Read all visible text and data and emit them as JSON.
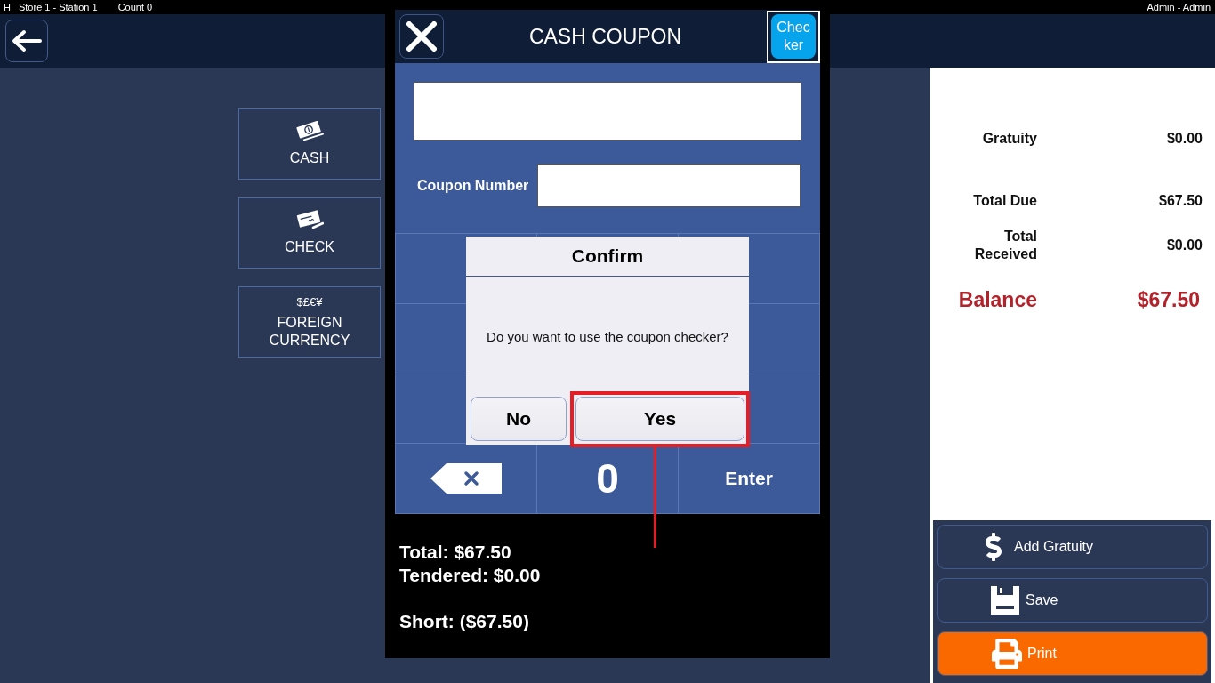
{
  "status_bar": {
    "mode": "H",
    "location": "Store 1 - Station 1",
    "count": "Count 0",
    "user": "Admin - Admin"
  },
  "payment_methods": [
    {
      "kind": "cash",
      "label": "CASH"
    },
    {
      "kind": "check",
      "label": "CHECK"
    },
    {
      "kind": "symbols",
      "symbols": "$£€¥",
      "label": "FOREIGN CURRENCY"
    }
  ],
  "summary": {
    "groups": [
      {
        "rows": [
          {
            "label": "Gratuity",
            "value": "$0.00"
          }
        ]
      },
      {
        "rows": [
          {
            "label": "Total Due",
            "value": "$67.50"
          },
          {
            "label": "Total Received",
            "value": "$0.00"
          }
        ]
      }
    ],
    "balance": {
      "label": "Balance",
      "value": "$67.50"
    }
  },
  "actions": [
    {
      "kind": "gratuity",
      "label": "Add Gratuity",
      "primary": false
    },
    {
      "kind": "save",
      "label": "Save",
      "primary": false
    },
    {
      "kind": "print",
      "label": "Print",
      "primary": true
    }
  ],
  "coupon_dialog": {
    "title": "CASH COUPON",
    "checker": {
      "label": "Checker",
      "focused": true
    },
    "fields": [
      {
        "kind": "display"
      },
      {
        "kind": "labeled",
        "label": "Coupon Number"
      }
    ],
    "keypad": [
      {
        "kind": "covered"
      },
      {
        "kind": "hidden"
      },
      {
        "kind": "covered"
      },
      {
        "kind": "covered"
      },
      {
        "kind": "hidden"
      },
      {
        "kind": "covered"
      },
      {
        "kind": "covered"
      },
      {
        "kind": "hidden"
      },
      {
        "kind": "covered"
      },
      {
        "kind": "backspace"
      },
      {
        "kind": "digit",
        "label": "0"
      },
      {
        "kind": "enter",
        "label": "Enter"
      }
    ],
    "totals": [
      {
        "lines": [
          "Total: $67.50",
          "Tendered: $0.00"
        ]
      },
      {
        "lines": [
          "Short: ($67.50)"
        ]
      }
    ]
  },
  "confirm": {
    "title": "Confirm",
    "message": "Do you want to use the coupon checker?",
    "buttons": [
      {
        "label": "No",
        "highlighted": false
      },
      {
        "label": "Yes",
        "highlighted": true
      }
    ]
  }
}
